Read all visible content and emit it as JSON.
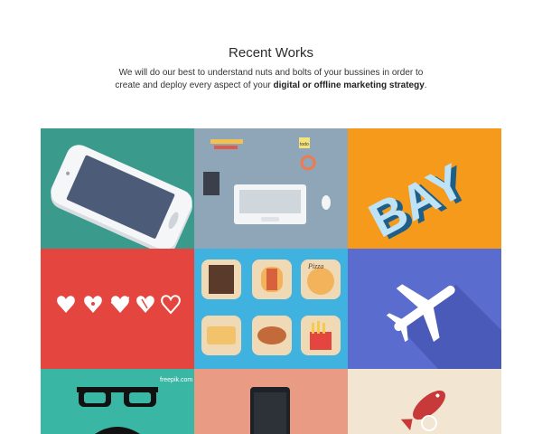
{
  "section": {
    "title": "Recent Works",
    "desc_line1": "We will do our best to understand nuts and bolts of your bussines in order to",
    "desc_line2_a": "create and deploy every aspect of your ",
    "desc_line2_bold": "digital or offline marketing strategy",
    "desc_line2_end": "."
  },
  "tiles": [
    {
      "name": "smartphone",
      "icon": "smartphone-icon",
      "color": "#3a9a8c"
    },
    {
      "name": "desk-laptop",
      "icon": "laptop-icon",
      "color": "#8ea6b8",
      "sticky_note": "todo"
    },
    {
      "name": "bay-3d-letters",
      "icon": "bay-text",
      "color": "#f59a1b",
      "text": "BAY"
    },
    {
      "name": "hearts",
      "icon": "hearts-icon",
      "color": "#e4463f"
    },
    {
      "name": "food-icons",
      "icon": "food-icon",
      "color": "#3fb2df",
      "pizza_label": "Pizza"
    },
    {
      "name": "airplane",
      "icon": "airplane-icon",
      "color": "#5a6ccd"
    },
    {
      "name": "glasses-mustache",
      "icon": "glasses-icon",
      "color": "#39b6a4",
      "watermark": "freepik.com"
    },
    {
      "name": "dark-phone",
      "icon": "phone-icon",
      "color": "#e99b83"
    },
    {
      "name": "fish",
      "icon": "fish-icon",
      "color": "#f2e6d2"
    }
  ]
}
